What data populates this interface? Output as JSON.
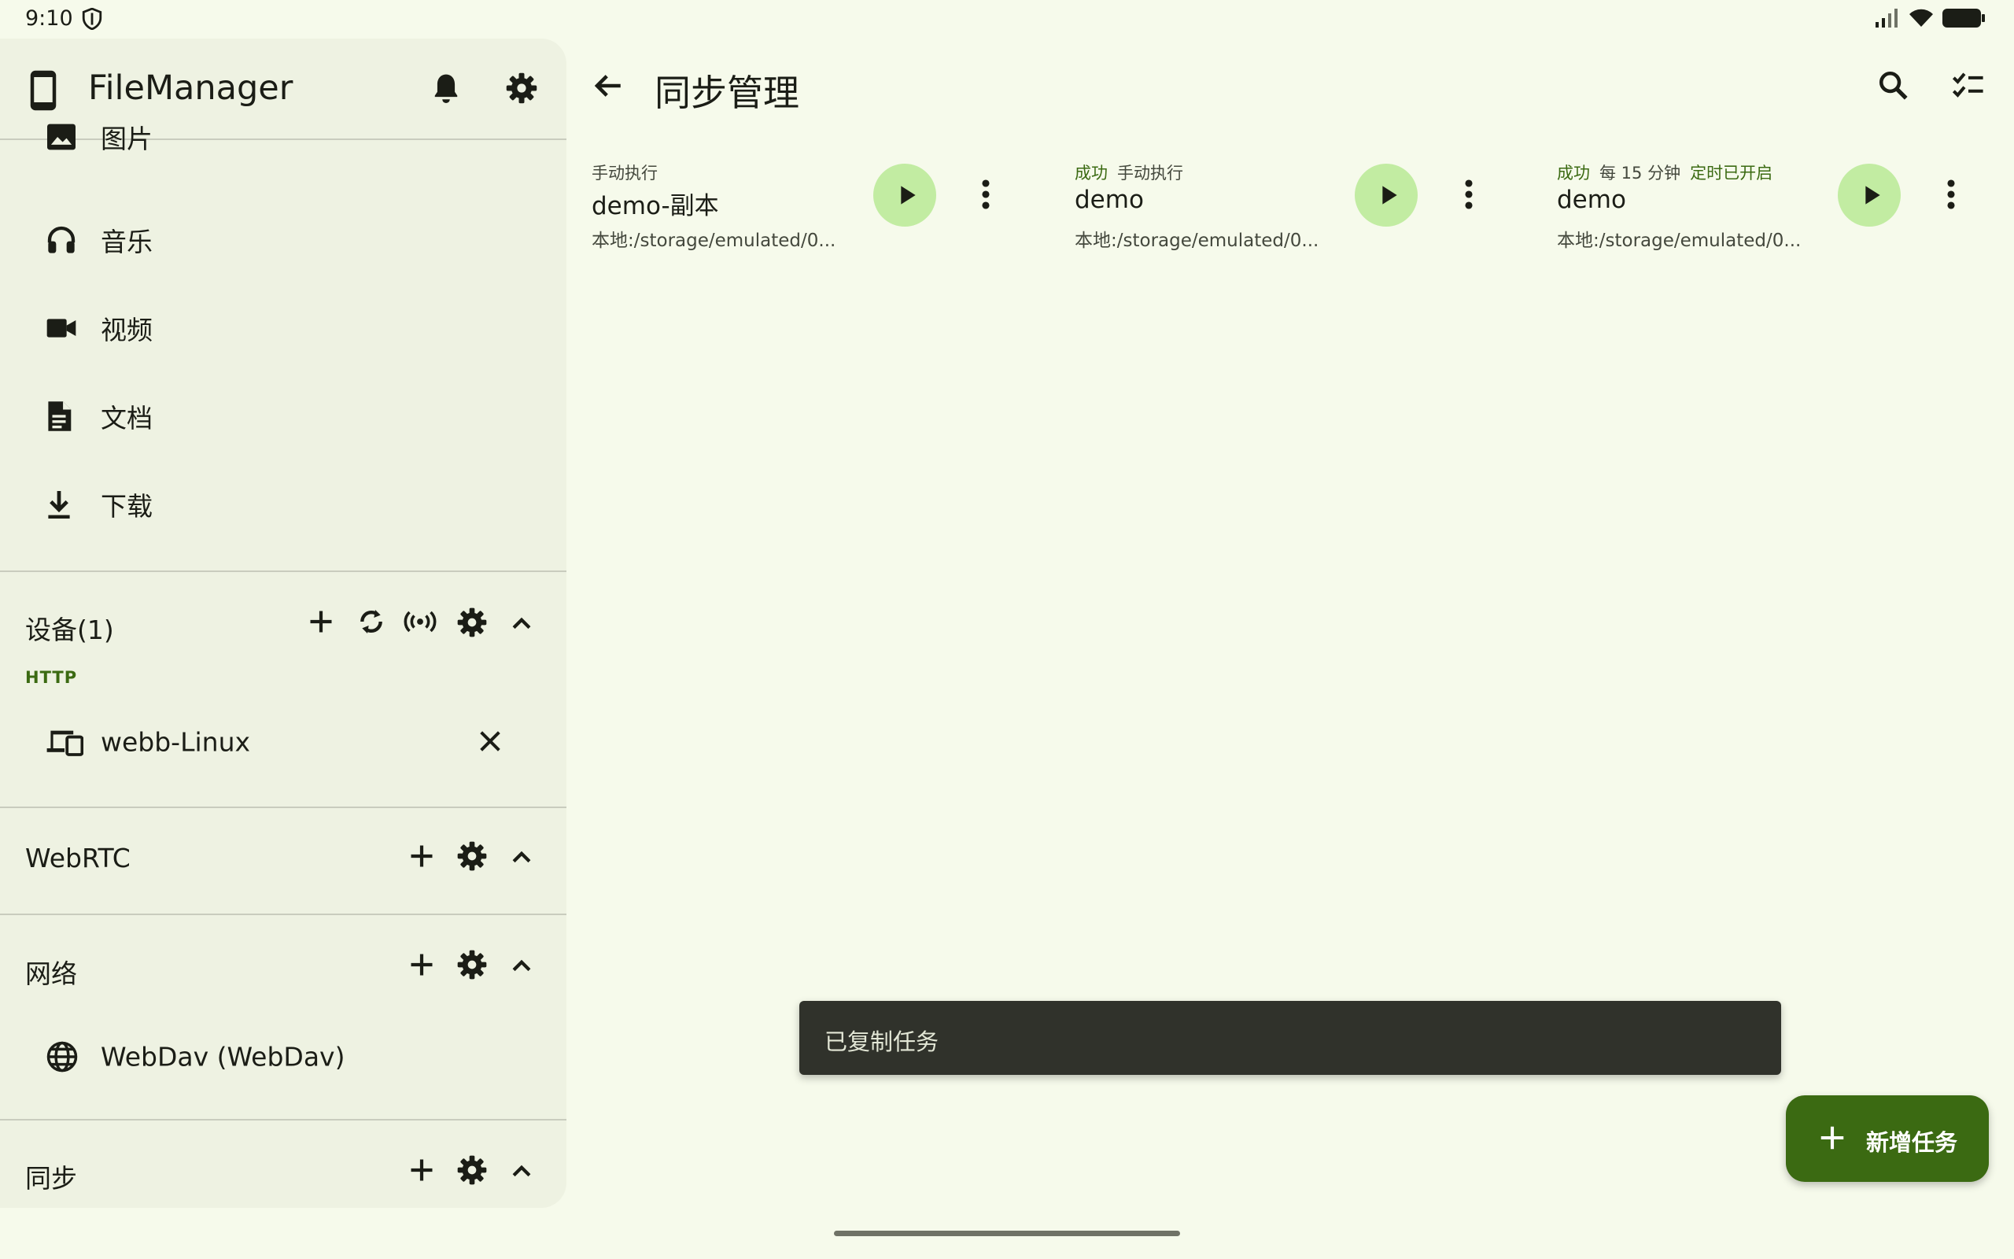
{
  "status_bar": {
    "time": "9:10"
  },
  "sidebar": {
    "app_title": "FileManager",
    "nav_items": [
      {
        "label": "图片",
        "icon": "image-icon"
      },
      {
        "label": "音乐",
        "icon": "headphones-icon"
      },
      {
        "label": "视频",
        "icon": "videocam-icon"
      },
      {
        "label": "文档",
        "icon": "document-icon"
      },
      {
        "label": "下载",
        "icon": "download-icon"
      }
    ],
    "devices": {
      "title": "设备(1)",
      "group_label": "HTTP",
      "items": [
        {
          "label": "webb-Linux"
        }
      ]
    },
    "webrtc": {
      "title": "WebRTC"
    },
    "network": {
      "title": "网络",
      "items": [
        {
          "label": "WebDav (WebDav)"
        }
      ]
    },
    "sync": {
      "title": "同步"
    }
  },
  "main": {
    "title": "同步管理",
    "tasks": [
      {
        "status": "",
        "mode": "手动执行",
        "schedule_state": "",
        "name": "demo-副本",
        "path": "本地:/storage/emulated/0..."
      },
      {
        "status": "成功",
        "mode": "手动执行",
        "schedule_state": "",
        "name": "demo",
        "path": "本地:/storage/emulated/0..."
      },
      {
        "status": "成功",
        "mode": "每 15 分钟",
        "schedule_state": "定时已开启",
        "name": "demo",
        "path": "本地:/storage/emulated/0..."
      }
    ],
    "snackbar": "已复制任务",
    "fab_label": "新增任务"
  },
  "colors": {
    "background": "#f6faeb",
    "sidebar": "#eef2e2",
    "accent": "#3b6a12",
    "play_button": "#c2eca2",
    "snackbar": "#30322b"
  }
}
